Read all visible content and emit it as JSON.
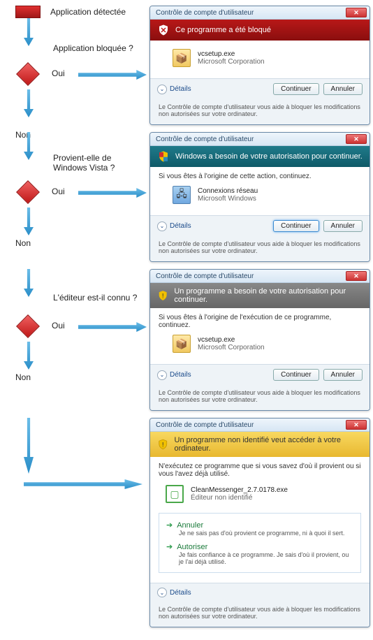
{
  "flow": {
    "step1": "Application détectée",
    "step2": "Application bloquée ?",
    "step3": "Provient-elle de Windows Vista ?",
    "step4": "L'éditeur est-il connu ?",
    "yes": "Oui",
    "no": "Non"
  },
  "common": {
    "title": "Contrôle de compte d'utilisateur",
    "details": "Détails",
    "continue": "Continuer",
    "cancel": "Annuler",
    "footer": "Le Contrôle de compte d'utilisateur vous aide à bloquer les modifications non autorisées sur votre ordinateur."
  },
  "d1": {
    "banner": "Ce programme a été bloqué",
    "app": "vcsetup.exe",
    "pub": "Microsoft Corporation"
  },
  "d2": {
    "banner": "Windows a besoin de votre autorisation pour continuer.",
    "lead": "Si vous êtes à l'origine de cette action, continuez.",
    "app": "Connexions réseau",
    "pub": "Microsoft Windows"
  },
  "d3": {
    "banner": "Un programme a besoin de votre autorisation pour continuer.",
    "lead": "Si vous êtes à l'origine de l'exécution de ce programme, continuez.",
    "app": "vcsetup.exe",
    "pub": "Microsoft Corporation"
  },
  "d4": {
    "banner": "Un programme non identifié veut accéder à votre ordinateur.",
    "lead": "N'exécutez ce programme que si vous savez d'où il provient ou si vous l'avez déjà utilisé.",
    "app": "CleanMessenger_2.7.0178.exe",
    "pub": "Éditeur non identifié",
    "opt1_t": "Annuler",
    "opt1_s": "Je ne sais pas d'où provient ce programme, ni à quoi il sert.",
    "opt2_t": "Autoriser",
    "opt2_s": "Je fais confiance à ce programme. Je sais d'où il provient, ou je l'ai déjà utilisé."
  }
}
